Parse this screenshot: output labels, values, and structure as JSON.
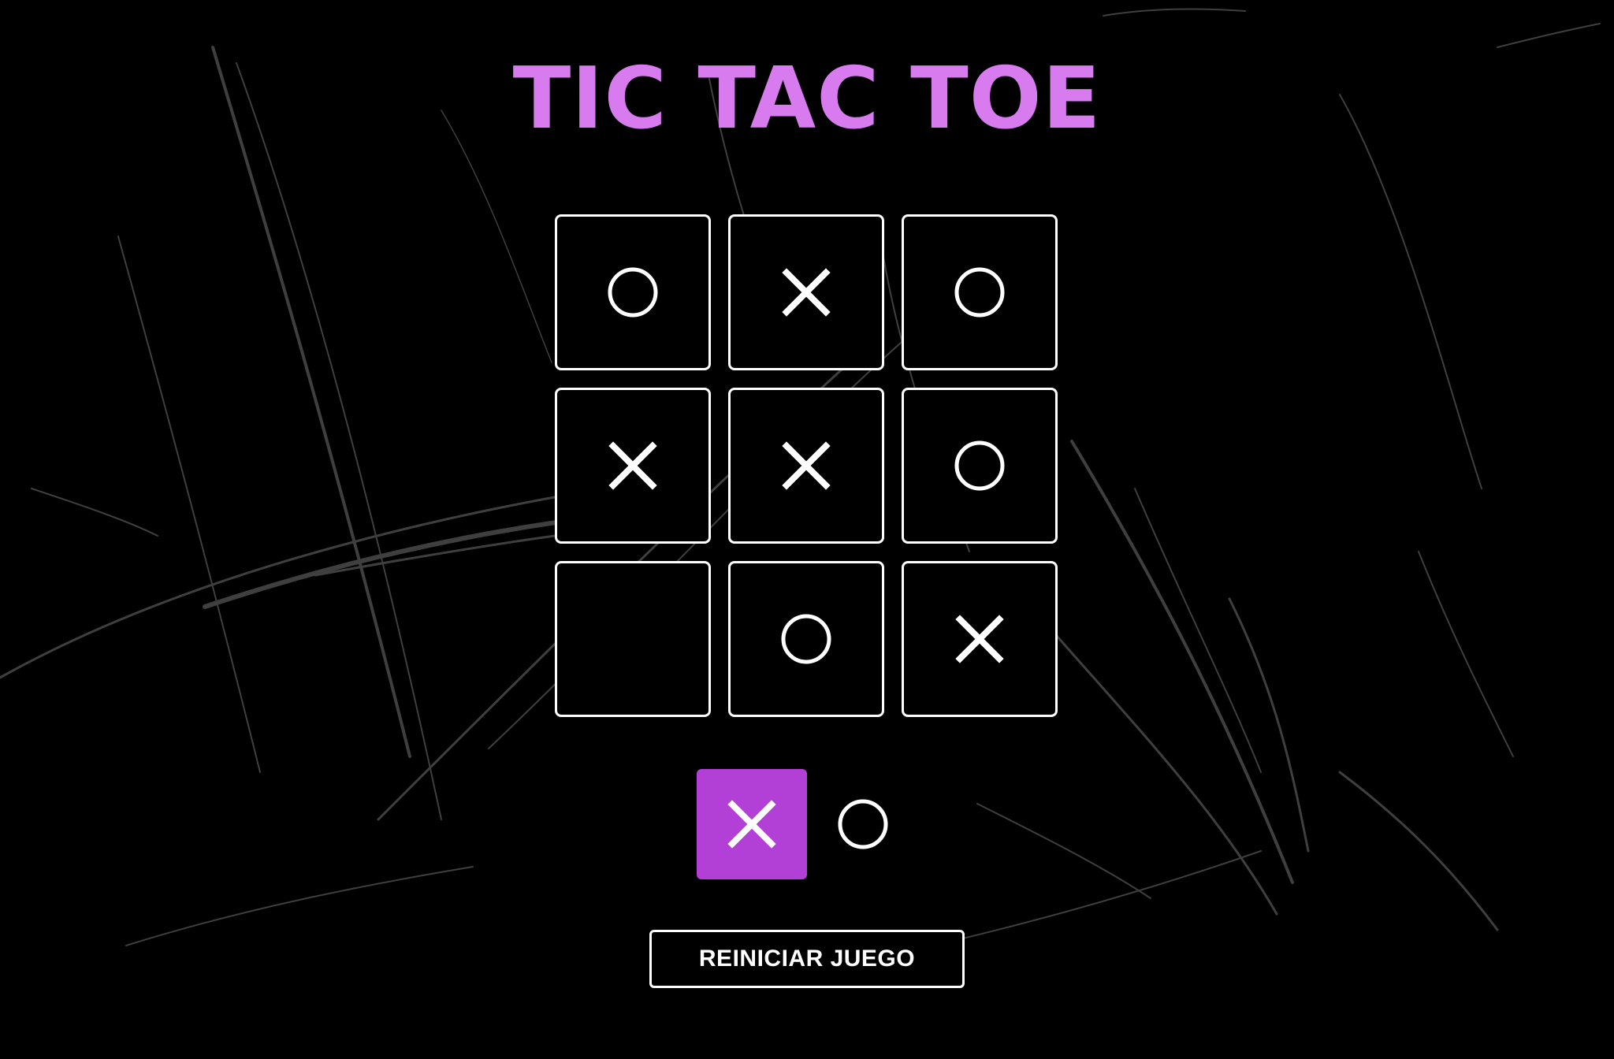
{
  "game": {
    "title": "TIC TAC TOE",
    "board": [
      {
        "mark": "O"
      },
      {
        "mark": "X"
      },
      {
        "mark": "O"
      },
      {
        "mark": "X"
      },
      {
        "mark": "X"
      },
      {
        "mark": "O"
      },
      {
        "mark": "empty"
      },
      {
        "mark": "O"
      },
      {
        "mark": "X"
      }
    ],
    "turn": {
      "options": [
        "X",
        "O"
      ],
      "active": "X"
    },
    "reset_label": "REINICIAR JUEGO"
  },
  "colors": {
    "background": "#000000",
    "title": "#d77bef",
    "accent": "#b23fd6",
    "marks": "#ffffff",
    "cell_border": "#ffffff",
    "scratches": "#4a4a4a"
  },
  "icons": {
    "x_mark": "x-mark-icon",
    "o_mark": "o-mark-icon"
  }
}
